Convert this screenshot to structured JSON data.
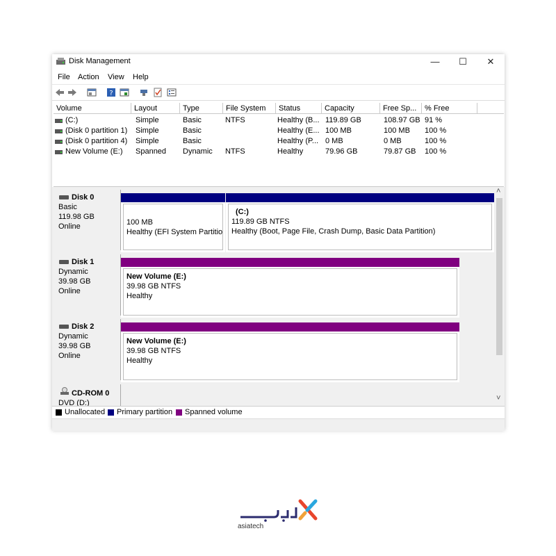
{
  "window": {
    "title": "Disk Management",
    "controls": {
      "minimize": "—",
      "maximize": "☐",
      "close": "✕"
    }
  },
  "menu": [
    "File",
    "Action",
    "View",
    "Help"
  ],
  "toolbar_icons": [
    "back-arrow-icon",
    "forward-arrow-icon",
    "properties-pane-icon",
    "help-icon",
    "console-icon",
    "connect-icon",
    "checklist-icon",
    "settings-list-icon"
  ],
  "volume_list": {
    "columns": [
      "Volume",
      "Layout",
      "Type",
      "File System",
      "Status",
      "Capacity",
      "Free Sp...",
      "% Free"
    ],
    "rows": [
      [
        "(C:)",
        "Simple",
        "Basic",
        "NTFS",
        "Healthy (B...",
        "119.89 GB",
        "108.97 GB",
        "91 %"
      ],
      [
        "(Disk 0 partition 1)",
        "Simple",
        "Basic",
        "",
        "Healthy (E...",
        "100 MB",
        "100 MB",
        "100 %"
      ],
      [
        "(Disk 0 partition 4)",
        "Simple",
        "Basic",
        "",
        "Healthy (P...",
        "0 MB",
        "0 MB",
        "100 %"
      ],
      [
        "New Volume (E:)",
        "Spanned",
        "Dynamic",
        "NTFS",
        "Healthy",
        "79.96 GB",
        "79.87 GB",
        "100 %"
      ]
    ]
  },
  "disks": [
    {
      "name": "Disk 0",
      "type": "Basic",
      "size": "119.98 GB",
      "state": "Online",
      "partitions": [
        {
          "title": "",
          "line1": "100 MB",
          "line2": "Healthy (EFI System Partition)",
          "color": "#000080"
        },
        {
          "title": "(C:)",
          "line1": "119.89 GB NTFS",
          "line2": "Healthy (Boot, Page File, Crash Dump, Basic Data Partition)",
          "color": "#000080"
        }
      ]
    },
    {
      "name": "Disk 1",
      "type": "Dynamic",
      "size": "39.98 GB",
      "state": "Online",
      "partitions": [
        {
          "title": "New Volume  (E:)",
          "line1": "39.98 GB NTFS",
          "line2": "Healthy",
          "color": "#800080"
        }
      ]
    },
    {
      "name": "Disk 2",
      "type": "Dynamic",
      "size": "39.98 GB",
      "state": "Online",
      "partitions": [
        {
          "title": "New Volume  (E:)",
          "line1": "39.98 GB NTFS",
          "line2": "Healthy",
          "color": "#800080"
        }
      ]
    },
    {
      "name": "CD-ROM 0",
      "type": "DVD (D:)"
    }
  ],
  "legend": [
    {
      "label": "Unallocated",
      "color": "#000000"
    },
    {
      "label": "Primary partition",
      "color": "#000080"
    },
    {
      "label": "Spanned volume",
      "color": "#800080"
    }
  ],
  "scrollbar": {
    "up": "˄",
    "down": "˅"
  },
  "brand": {
    "text": "asiatech",
    "accent": "#e8452c",
    "secondary": "#2aa7df"
  }
}
